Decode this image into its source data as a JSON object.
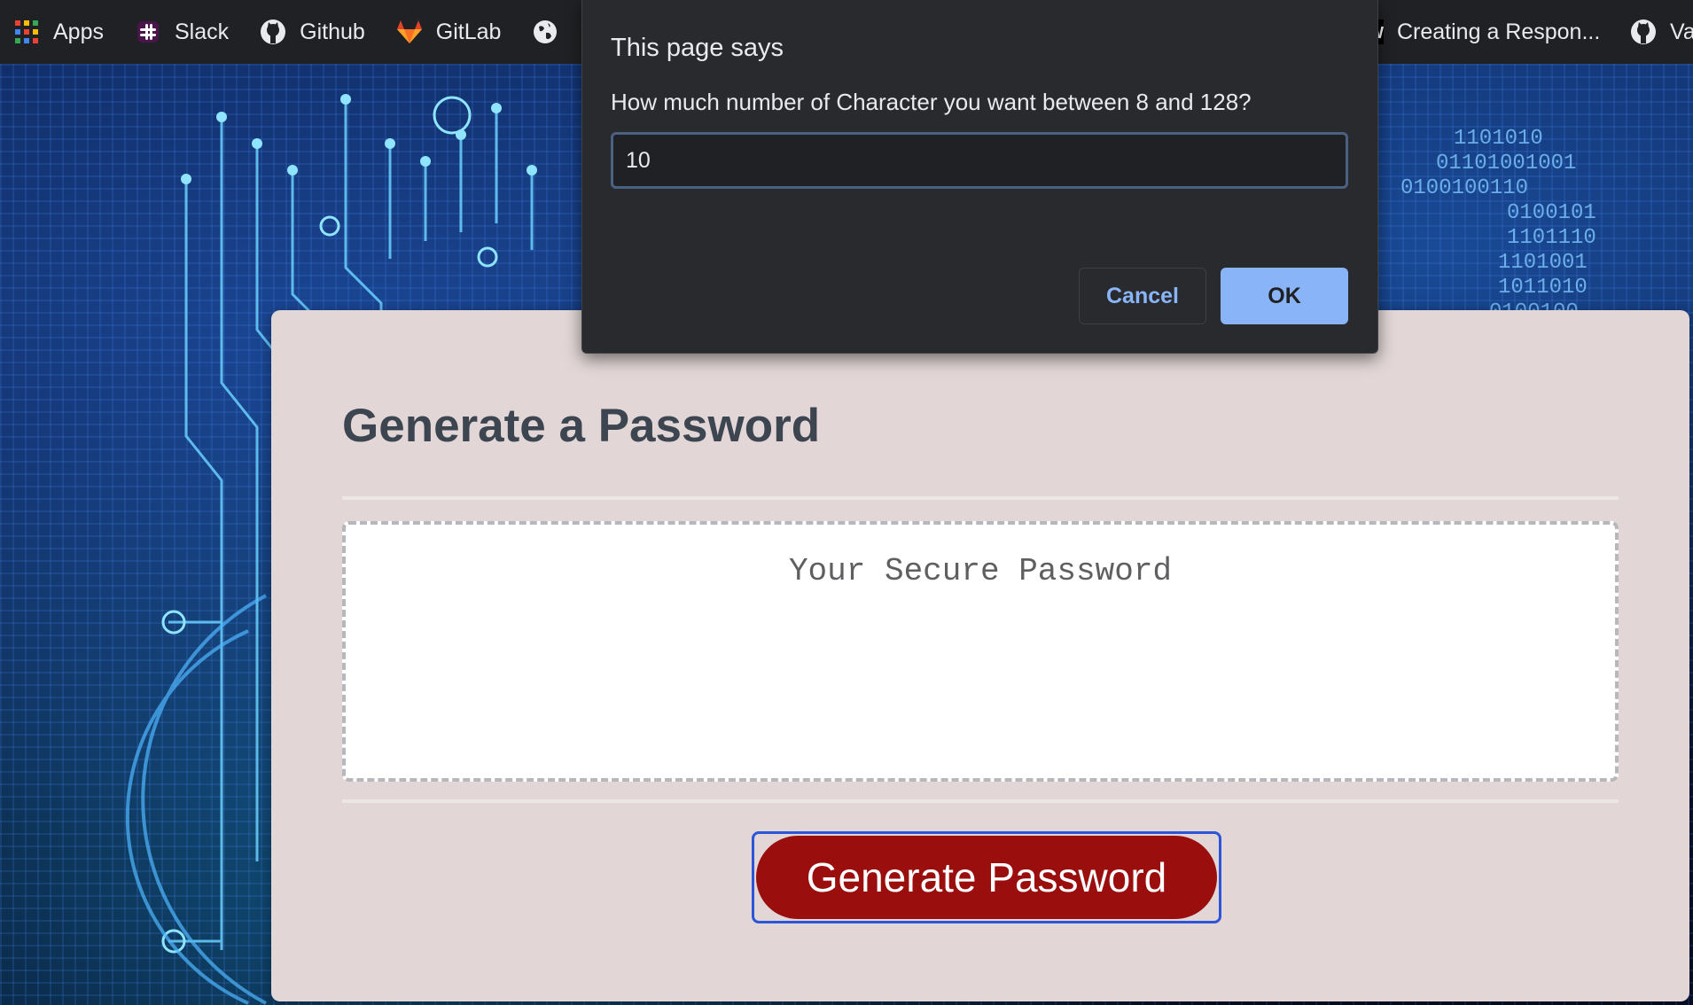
{
  "bookmarks": {
    "items": [
      {
        "label": "Apps",
        "icon": "apps-grid-icon"
      },
      {
        "label": "Slack",
        "icon": "slack-icon"
      },
      {
        "label": "Github",
        "icon": "github-icon"
      },
      {
        "label": "GitLab",
        "icon": "gitlab-icon"
      },
      {
        "label": "",
        "icon": "globe-icon"
      }
    ],
    "right_items": [
      {
        "label": "Creating a Respon...",
        "icon": "w-icon"
      },
      {
        "label": "Va",
        "icon": "github-icon"
      }
    ]
  },
  "dialog": {
    "title": "This page says",
    "message": "How much number of Character you want between 8 and 128?",
    "input_value": "10",
    "cancel_label": "Cancel",
    "ok_label": "OK"
  },
  "card": {
    "title": "Generate a Password",
    "password_placeholder": "Your Secure Password",
    "generate_label": "Generate Password"
  },
  "colors": {
    "card_bg": "#e2d6d6",
    "button_red": "#9a0e0e",
    "dialog_bg": "#292a2d",
    "ok_blue": "#8ab4f8"
  }
}
